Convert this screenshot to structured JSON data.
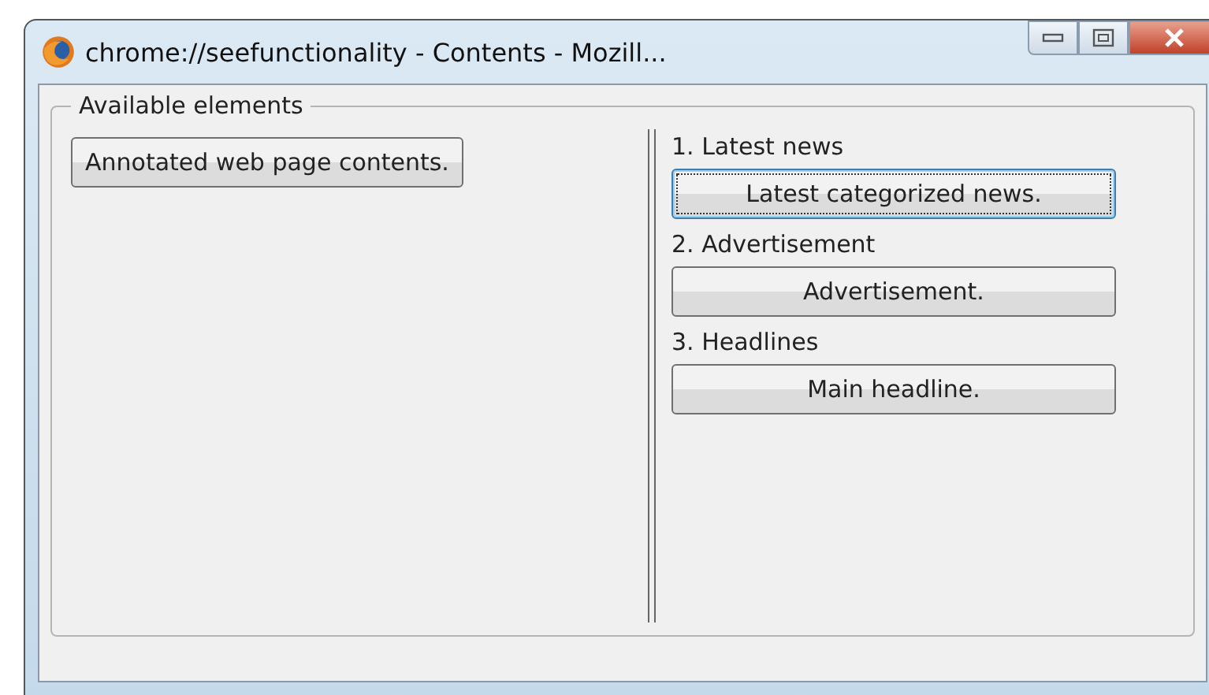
{
  "window": {
    "title": "chrome://seefunctionality - Contents - Mozill..."
  },
  "group": {
    "legend": "Available elements",
    "left_button": "Annotated web page contents.",
    "sections": [
      {
        "heading": "1. Latest news",
        "button": "Latest categorized news.",
        "focused": true
      },
      {
        "heading": "2. Advertisement",
        "button": "Advertisement.",
        "focused": false
      },
      {
        "heading": "3. Headlines",
        "button": "Main headline.",
        "focused": false
      }
    ]
  }
}
